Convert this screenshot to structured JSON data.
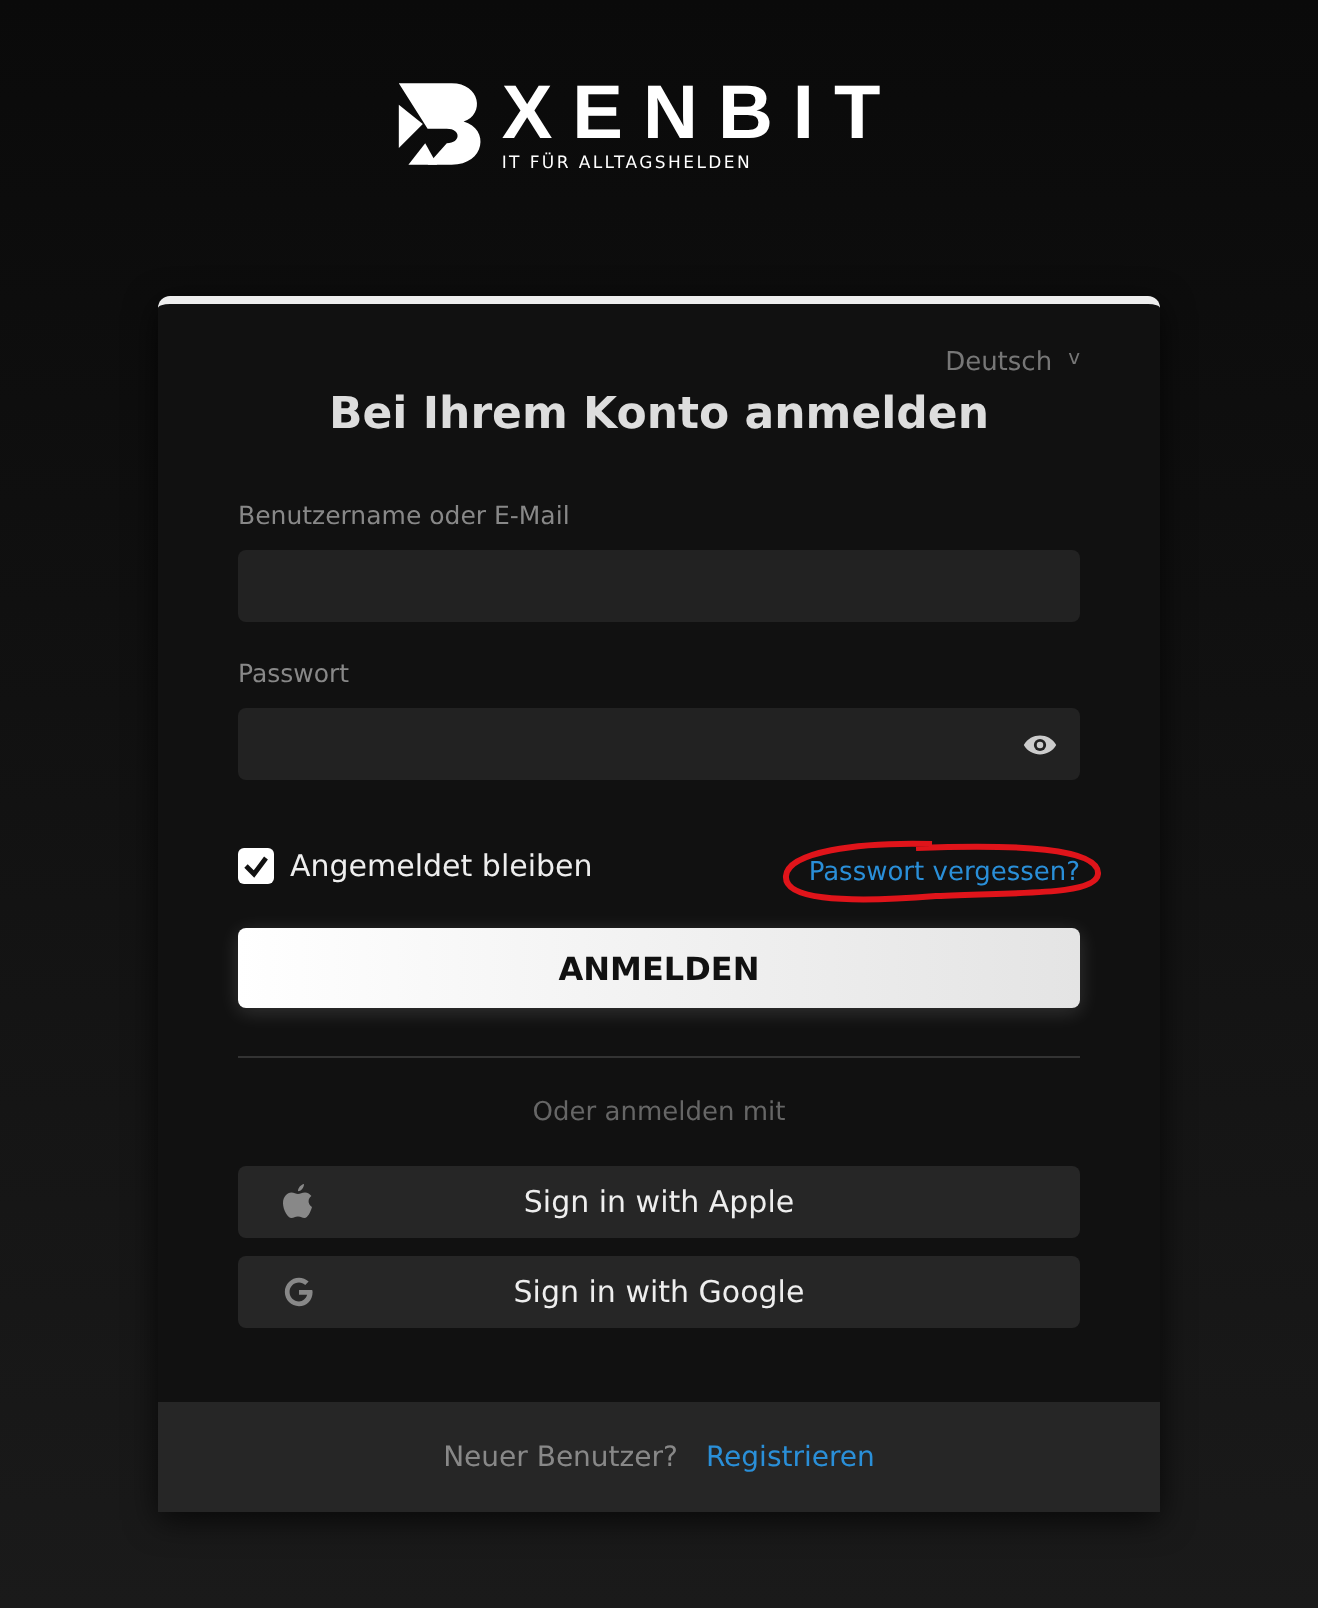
{
  "logo": {
    "name": "XENBIT",
    "tagline": "IT FÜR ALLTAGSHELDEN"
  },
  "language": {
    "label": "Deutsch",
    "caret": "v"
  },
  "title": "Bei Ihrem Konto anmelden",
  "fields": [
    {
      "label": "Benutzername oder E-Mail",
      "kind": "text"
    },
    {
      "label": "Passwort",
      "kind": "password"
    }
  ],
  "remember": {
    "label": "Angemeldet bleiben",
    "checked": true
  },
  "forgot_link": {
    "label": "Passwort vergessen?",
    "annotated": true
  },
  "submit": "ANMELDEN",
  "social_heading": "Oder anmelden mit",
  "social": [
    {
      "label": "Sign in with Apple",
      "kind": "apple"
    },
    {
      "label": "Sign in with Google",
      "kind": "google"
    }
  ],
  "footer": {
    "question": "Neuer Benutzer?",
    "link": "Registrieren"
  }
}
